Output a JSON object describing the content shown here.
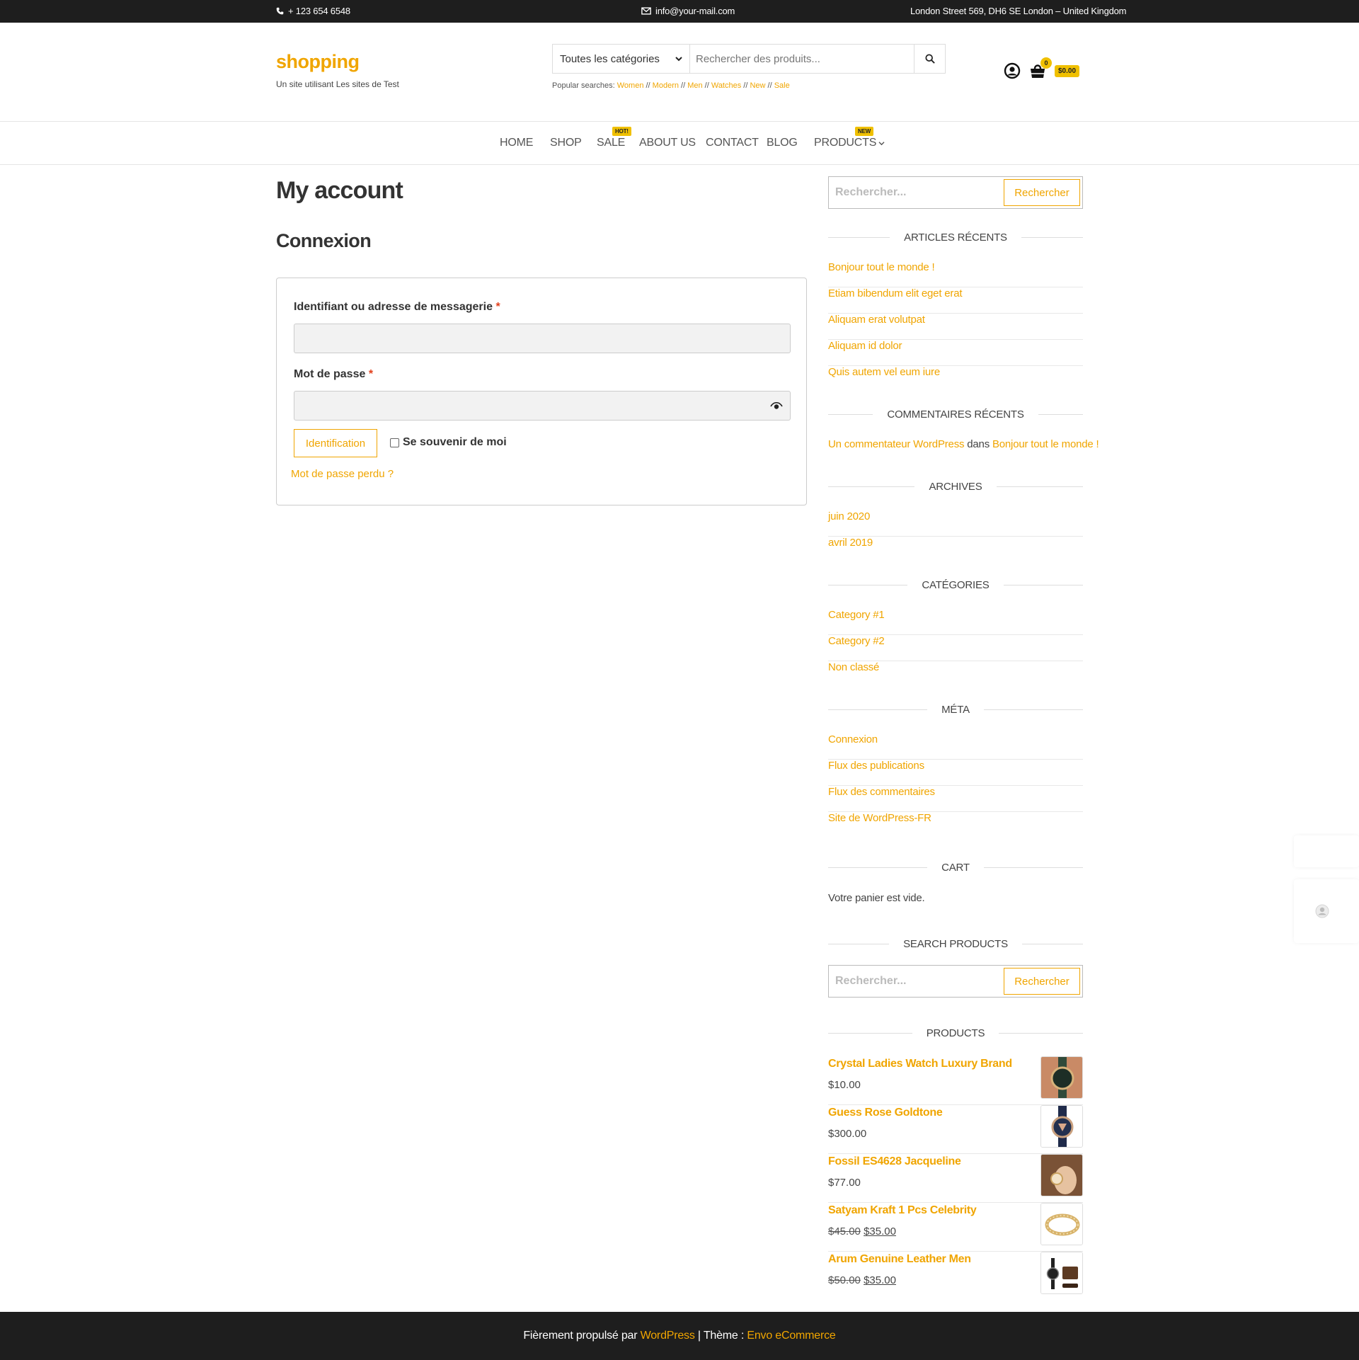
{
  "topbar": {
    "phone": "+ 123 654 6548",
    "email": "info@your-mail.com",
    "address": "London Street 569, DH6 SE London – United Kingdom"
  },
  "header": {
    "site_title": "shopping",
    "tagline": "Un site utilisant Les sites de Test",
    "search": {
      "category_selected": "Toutes les catégories",
      "placeholder": "Rechercher des produits..."
    },
    "popular_label": "Popular searches:",
    "popular": [
      "Women",
      "Modern",
      "Men",
      "Watches",
      "New",
      "Sale"
    ],
    "cart_count": "0",
    "cart_total": "$0.00"
  },
  "nav": {
    "items": [
      {
        "label": "HOME"
      },
      {
        "label": "SHOP"
      },
      {
        "label": "SALE",
        "badge": "HOT!"
      },
      {
        "label": "ABOUT US"
      },
      {
        "label": "CONTACT"
      },
      {
        "label": "BLOG"
      },
      {
        "label": "PRODUCTS",
        "badge": "NEW"
      }
    ]
  },
  "main": {
    "page_title": "My account",
    "section_title": "Connexion",
    "username_label": "Identifiant ou adresse de messagerie",
    "password_label": "Mot de passe",
    "required_mark": "*",
    "login_button": "Identification",
    "remember_label": "Se souvenir de moi",
    "lost_password": "Mot de passe perdu ?"
  },
  "sidebar": {
    "search_placeholder": "Rechercher...",
    "search_button": "Rechercher",
    "recent_posts_title": "ARTICLES RÉCENTS",
    "recent_posts": [
      "Bonjour tout le monde !",
      "Etiam bibendum elit eget erat",
      "Aliquam erat volutpat",
      "Aliquam id dolor",
      "Quis autem vel eum iure"
    ],
    "recent_comments_title": "COMMENTAIRES RÉCENTS",
    "comment_author": "Un commentateur WordPress",
    "comment_in": "dans",
    "comment_post": "Bonjour tout le monde !",
    "archives_title": "ARCHIVES",
    "archives": [
      "juin 2020",
      "avril 2019"
    ],
    "categories_title": "CATÉGORIES",
    "categories": [
      "Category #1",
      "Category #2",
      "Non classé"
    ],
    "meta_title": "MÉTA",
    "meta": [
      "Connexion",
      "Flux des publications",
      "Flux des commentaires",
      "Site de WordPress-FR"
    ],
    "cart_title": "CART",
    "cart_empty": "Votre panier est vide.",
    "search_products_title": "SEARCH PRODUCTS",
    "products_title": "PRODUCTS",
    "products": [
      {
        "name": "Crystal Ladies Watch Luxury Brand",
        "price": "$10.00",
        "old_price": ""
      },
      {
        "name": "Guess Rose Goldtone",
        "price": "$300.00",
        "old_price": ""
      },
      {
        "name": "Fossil ES4628 Jacqueline",
        "price": "$77.00",
        "old_price": ""
      },
      {
        "name": "Satyam Kraft 1 Pcs Celebrity",
        "price": "$35.00",
        "old_price": "$45.00"
      },
      {
        "name": "Arum Genuine Leather Men",
        "price": "$35.00",
        "old_price": "$50.00"
      }
    ]
  },
  "footer": {
    "prefix": "Fièrement propulsé par",
    "wp_link": "WordPress",
    "separator": "| Thème :",
    "theme_link": "Envo eCommerce"
  },
  "colors": {
    "accent": "#f0a500",
    "badge": "#f0c000",
    "dark_bar": "#1e1e1e"
  }
}
